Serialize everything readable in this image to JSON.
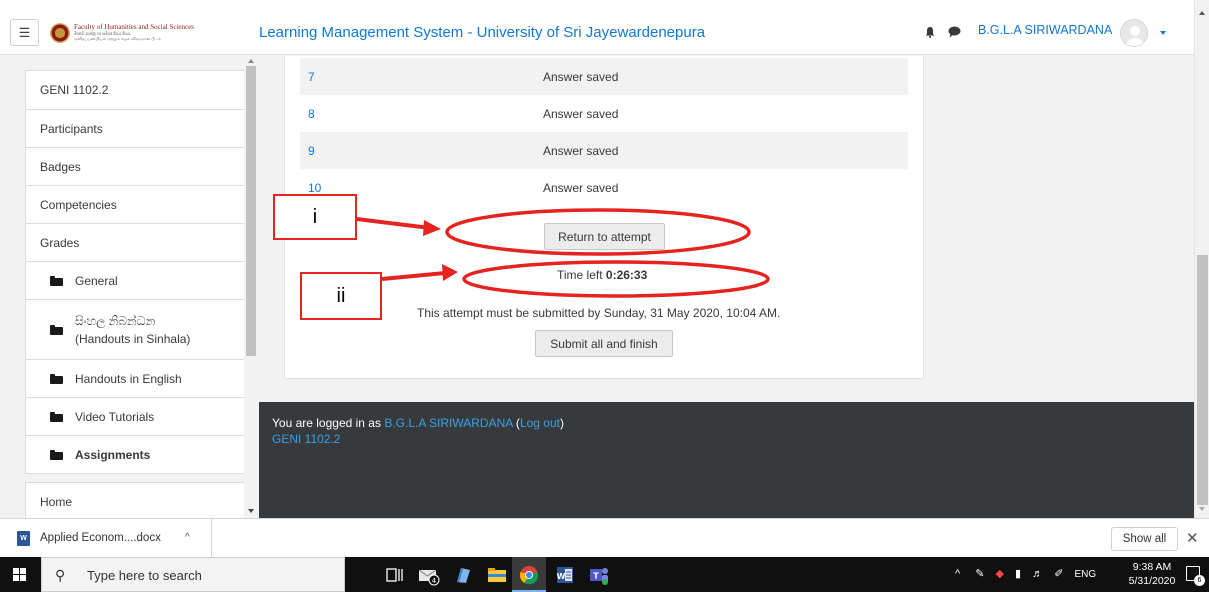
{
  "header": {
    "menu_icon": "hamburger-icon",
    "logo": {
      "line1": "Faculty of Humanities and Social Sciences",
      "line2": "මානව ශාස්ත්‍ර හා සමාජ විද්‍යා පීඨය",
      "line3": "மனிதப்பண்பியல் மற்றும் சமூக விஞ்ஞான பீடம்"
    },
    "site_title": "Learning Management System - University of Sri Jayewardenepura",
    "notification_icon": "bell-icon",
    "messages_icon": "chat-icon",
    "user_name": "B.G.L.A SIRIWARDANA",
    "user_menu_icon": "caret-down-icon"
  },
  "nav": {
    "course_items": [
      {
        "label": "GENI 1102.2",
        "type": "course"
      },
      {
        "label": "Participants",
        "type": "link"
      },
      {
        "label": "Badges",
        "type": "link"
      },
      {
        "label": "Competencies",
        "type": "link"
      },
      {
        "label": "Grades",
        "type": "link"
      },
      {
        "label": "General",
        "type": "section"
      },
      {
        "label": "සිංහල නිබන්ධන",
        "label2": "(Handouts in Sinhala)",
        "type": "section"
      },
      {
        "label": "Handouts in English",
        "type": "section"
      },
      {
        "label": "Video Tutorials",
        "type": "section"
      },
      {
        "label": "Assignments",
        "type": "section"
      }
    ],
    "home_label": "Home"
  },
  "summary": {
    "rows": [
      {
        "question": "7",
        "status": "Answer saved"
      },
      {
        "question": "8",
        "status": "Answer saved"
      },
      {
        "question": "9",
        "status": "Answer saved"
      },
      {
        "question": "10",
        "status": "Answer saved"
      }
    ],
    "return_button": "Return to attempt",
    "time_left_label": "Time left",
    "time_left_value": "0:26:33",
    "deadline_text": "This attempt must be submitted by Sunday, 31 May 2020, 10:04 AM.",
    "submit_button": "Submit all and finish"
  },
  "footer": {
    "logged_in_prefix": "You are logged in as",
    "user_link": "B.G.L.A SIRIWARDANA",
    "open_paren": " (",
    "logout_link": "Log out",
    "close_paren": ")",
    "course_link": "GENI 1102.2"
  },
  "annotations": {
    "label_i": "i",
    "label_ii": "ii",
    "color": "#e52421"
  },
  "downloads": {
    "file_name": "Applied Econom....docx",
    "file_icon": "word-file-icon",
    "show_all": "Show all",
    "close_icon": "close-icon"
  },
  "taskbar": {
    "search_placeholder": "Type here to search",
    "mail_badge": "4",
    "tray_text": "ENG",
    "time": "9:38 AM",
    "date": "5/31/2020",
    "notification_count": "6"
  }
}
